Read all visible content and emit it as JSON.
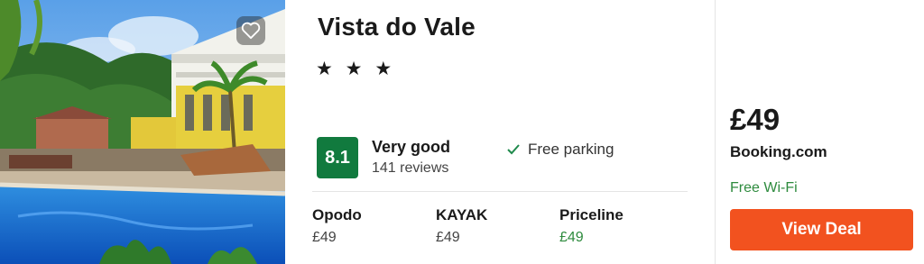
{
  "hotel": {
    "name": "Vista do Vale",
    "stars": "★ ★ ★",
    "score": "8.1",
    "rating_label": "Very good",
    "reviews": "141 reviews",
    "amenity": "Free parking",
    "photo_icon": "hotel-pool-photo",
    "favorite_icon": "heart-icon"
  },
  "providers": [
    {
      "name": "Opodo",
      "price": "£49"
    },
    {
      "name": "KAYAK",
      "price": "£49"
    },
    {
      "name": "Priceline",
      "price": "£49"
    }
  ],
  "deal": {
    "price": "£49",
    "site": "Booking.com",
    "perk": "Free Wi-Fi",
    "button_label": "View Deal"
  },
  "colors": {
    "score_bg": "#117a3e",
    "best_price": "#2e8b3e",
    "cta": "#f2521f"
  }
}
